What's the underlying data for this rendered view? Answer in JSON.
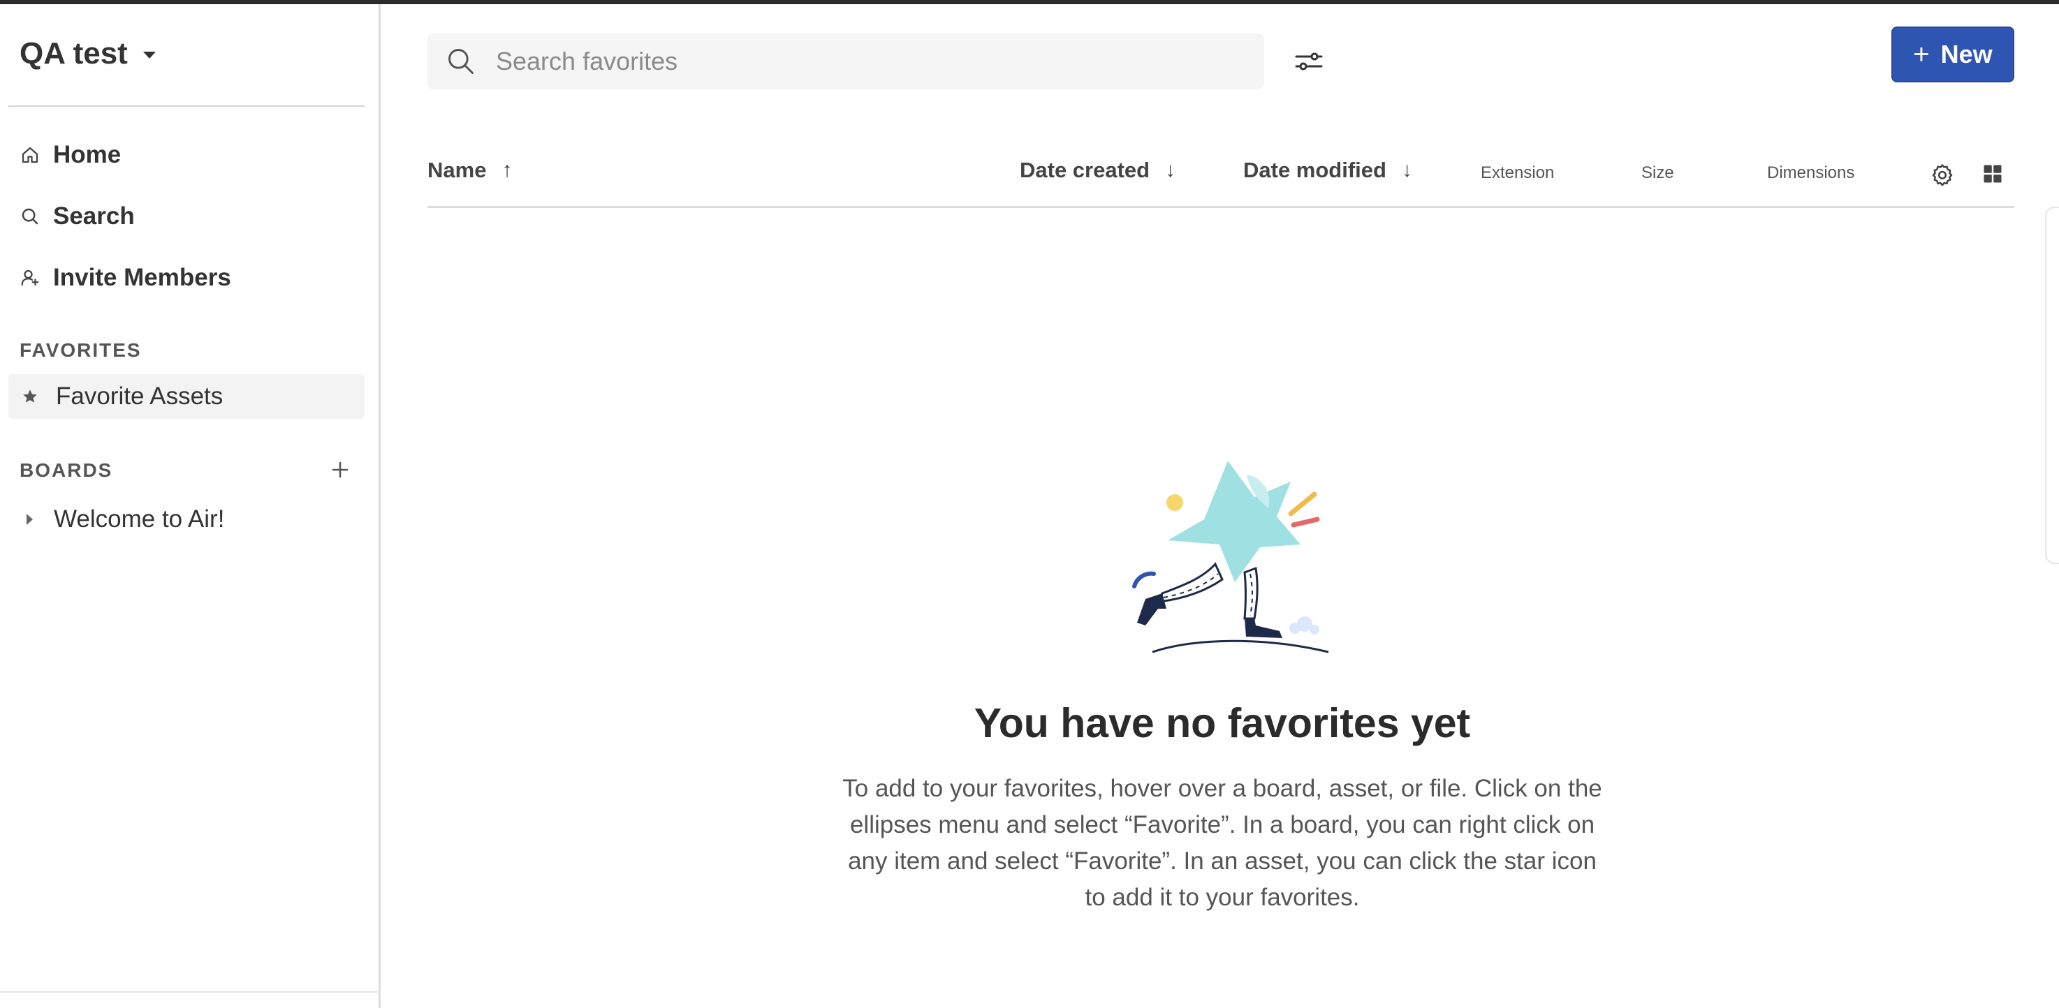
{
  "workspace": {
    "name": "QA test"
  },
  "nav": [
    {
      "label": "Home",
      "icon": "home-icon"
    },
    {
      "label": "Search",
      "icon": "search-icon"
    },
    {
      "label": "Invite Members",
      "icon": "person-add-icon"
    }
  ],
  "favorites": {
    "heading": "FAVORITES",
    "item_label": "Favorite Assets",
    "item_icon": "star-icon"
  },
  "boards": {
    "heading": "BOARDS",
    "items": [
      {
        "label": "Welcome to Air!"
      }
    ]
  },
  "search": {
    "placeholder": "Search favorites"
  },
  "new_button": {
    "label": "New"
  },
  "columns": [
    {
      "label": "Name",
      "sort": "ascending"
    },
    {
      "label": "Date created",
      "sort": "descending"
    },
    {
      "label": "Date modified",
      "sort": "descending"
    },
    {
      "label": "Extension"
    },
    {
      "label": "Size"
    },
    {
      "label": "Dimensions"
    }
  ],
  "empty_state": {
    "title": "You have no favorites yet",
    "description": "To add to your favorites, hover over a board, asset, or file. Click on the ellipses menu and select “Favorite”. In a board, you can right click on any item and select “Favorite”. In an asset, you can click the star icon to add it to your favorites."
  },
  "colors": {
    "primary": "#2f55b3",
    "illustration_star": "#9fe0e3",
    "sidebar_active_bg": "#f3f3f3"
  }
}
